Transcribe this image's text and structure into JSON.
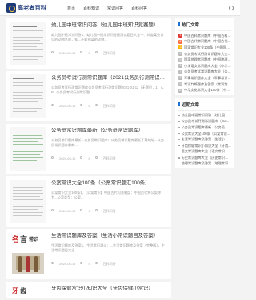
{
  "header": {
    "logo_text": "高老者百科",
    "nav": [
      "首页",
      "百科知识",
      "常识问答",
      "百科问答"
    ]
  },
  "articles": [
    {
      "title": "幼儿园中班常识问答（幼儿园中班知识竞赛题）",
      "excerpt": "幼儿园中班常识问答1、幼儿园中班常识问答题测试题目大全一、知道某些常见的动物名称，知...不要把某的动物...",
      "date": "2024-05-12",
      "views": "5",
      "category": "百科问答",
      "thumb": "doc"
    },
    {
      "title": "公务员考试行测常识题库（2021公务员行测常识题1000题）",
      "excerpt": "公务员考试行测常识题库公务员考试行测常识题2021-01-12（无题目，1、A、B...公务员考试行测常识题...",
      "date": "2024-05-12",
      "views": "6",
      "category": "百科问答",
      "thumb": "doc"
    },
    {
      "title": "公务员常识题库最新（公务员常识题库）",
      "excerpt": "公务员常识题库最新...公务员常识题库：公务员常识题库最新下载地址...公务员常识题库最新...",
      "date": "2024-05-12",
      "views": "6",
      "category": "百科问答",
      "thumb": "green"
    },
    {
      "title": "公案常识大全100条（公案常识题汇100条）",
      "excerpt": "公案常识大全100条1、【公案常识】中国古代司法制度：中国古代将公案称为...公案类型：公案...",
      "date": "2024-05-12",
      "views": "3",
      "category": "百科问答",
      "thumb": "doc"
    },
    {
      "title": "生活常识题库及答案（生活小常识题目及答案）",
      "excerpt": "生活常识题库及答案1、生活常识测试：...生活常识题库及答案（完整版），生活常识题目大全...",
      "date": "2024-05-12",
      "views": "5",
      "category": "百科问答",
      "thumb": "cn"
    },
    {
      "title": "牙齿保健常识小知识大全（牙齿保健小常识）",
      "excerpt": "",
      "date": "",
      "views": "",
      "category": "",
      "thumb": "cn2"
    }
  ],
  "sidebar": {
    "hot_title": "热门文章",
    "hot": [
      "中国百科常识题库（中国百科常识题...",
      "中国古代常识题库（中国古代常识题...",
      "国家常识大全100条（中国国家常...",
      "公务员考试行测常识题库大全（公务...",
      "国家地理常识题库（中国地理常识...",
      "小学语文常识题库大全（小学语文...",
      "公务员考试常识题库大全（公务员...",
      "军事常识题库大全（军事常识100...",
      "常识判断题库及答案（常识判断...",
      "中华文化常识大全100条（中华..."
    ],
    "latest_title": "近期文章",
    "latest": [
      "幼儿园中班常识问答（幼儿园中班...",
      "公务员考试行测常识题库（2021...",
      "公务员常识题库最新（公务员常识...",
      "公案常识大全100条（公案常识...",
      "生活常识题库及答案（生活小常识...",
      "牙齿保健常识小知识大全（牙齿...",
      "语文常识题库大全（语文常识...",
      "历史常识题库大全（历史常识题库...",
      "地理常识题库及答案（地理常识..."
    ]
  }
}
